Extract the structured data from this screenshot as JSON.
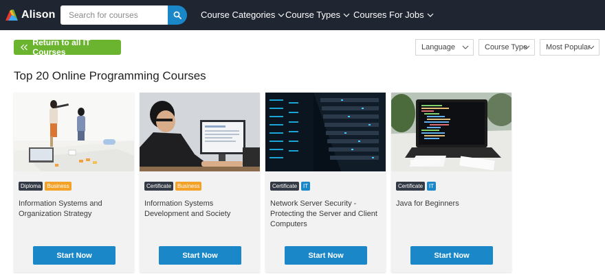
{
  "header": {
    "logo_text": "Alison",
    "search_placeholder": "Search for courses",
    "nav": [
      {
        "label": "Course Categories"
      },
      {
        "label": "Course Types"
      },
      {
        "label": "Courses For Jobs"
      }
    ]
  },
  "back_button": {
    "label": "Return to all IT Courses"
  },
  "filters": [
    {
      "label": "Language"
    },
    {
      "label": "Course Type"
    },
    {
      "label": "Most Popular"
    }
  ],
  "page_title": "Top 20 Online Programming Courses",
  "colors": {
    "header_bg": "#1f2531",
    "accent_blue": "#1a87c9",
    "accent_green": "#6bb42f",
    "tag_orange": "#f3a127",
    "tag_dark": "#333a45"
  },
  "cards": [
    {
      "tags": [
        {
          "label": "Diploma",
          "style": "dark"
        },
        {
          "label": "Business",
          "style": "orange"
        }
      ],
      "title": "Information Systems and Organization Strategy",
      "button": "Start Now"
    },
    {
      "tags": [
        {
          "label": "Certificate",
          "style": "dark"
        },
        {
          "label": "Business",
          "style": "orange"
        }
      ],
      "title": "Information Systems Development and Society",
      "button": "Start Now"
    },
    {
      "tags": [
        {
          "label": "Certificate",
          "style": "dark"
        },
        {
          "label": "IT",
          "style": "blue"
        }
      ],
      "title": "Network Server Security - Protecting the Server and Client Computers",
      "button": "Start Now"
    },
    {
      "tags": [
        {
          "label": "Certificate",
          "style": "dark"
        },
        {
          "label": "IT",
          "style": "blue"
        }
      ],
      "title": "Java for Beginners",
      "button": "Start Now"
    }
  ]
}
